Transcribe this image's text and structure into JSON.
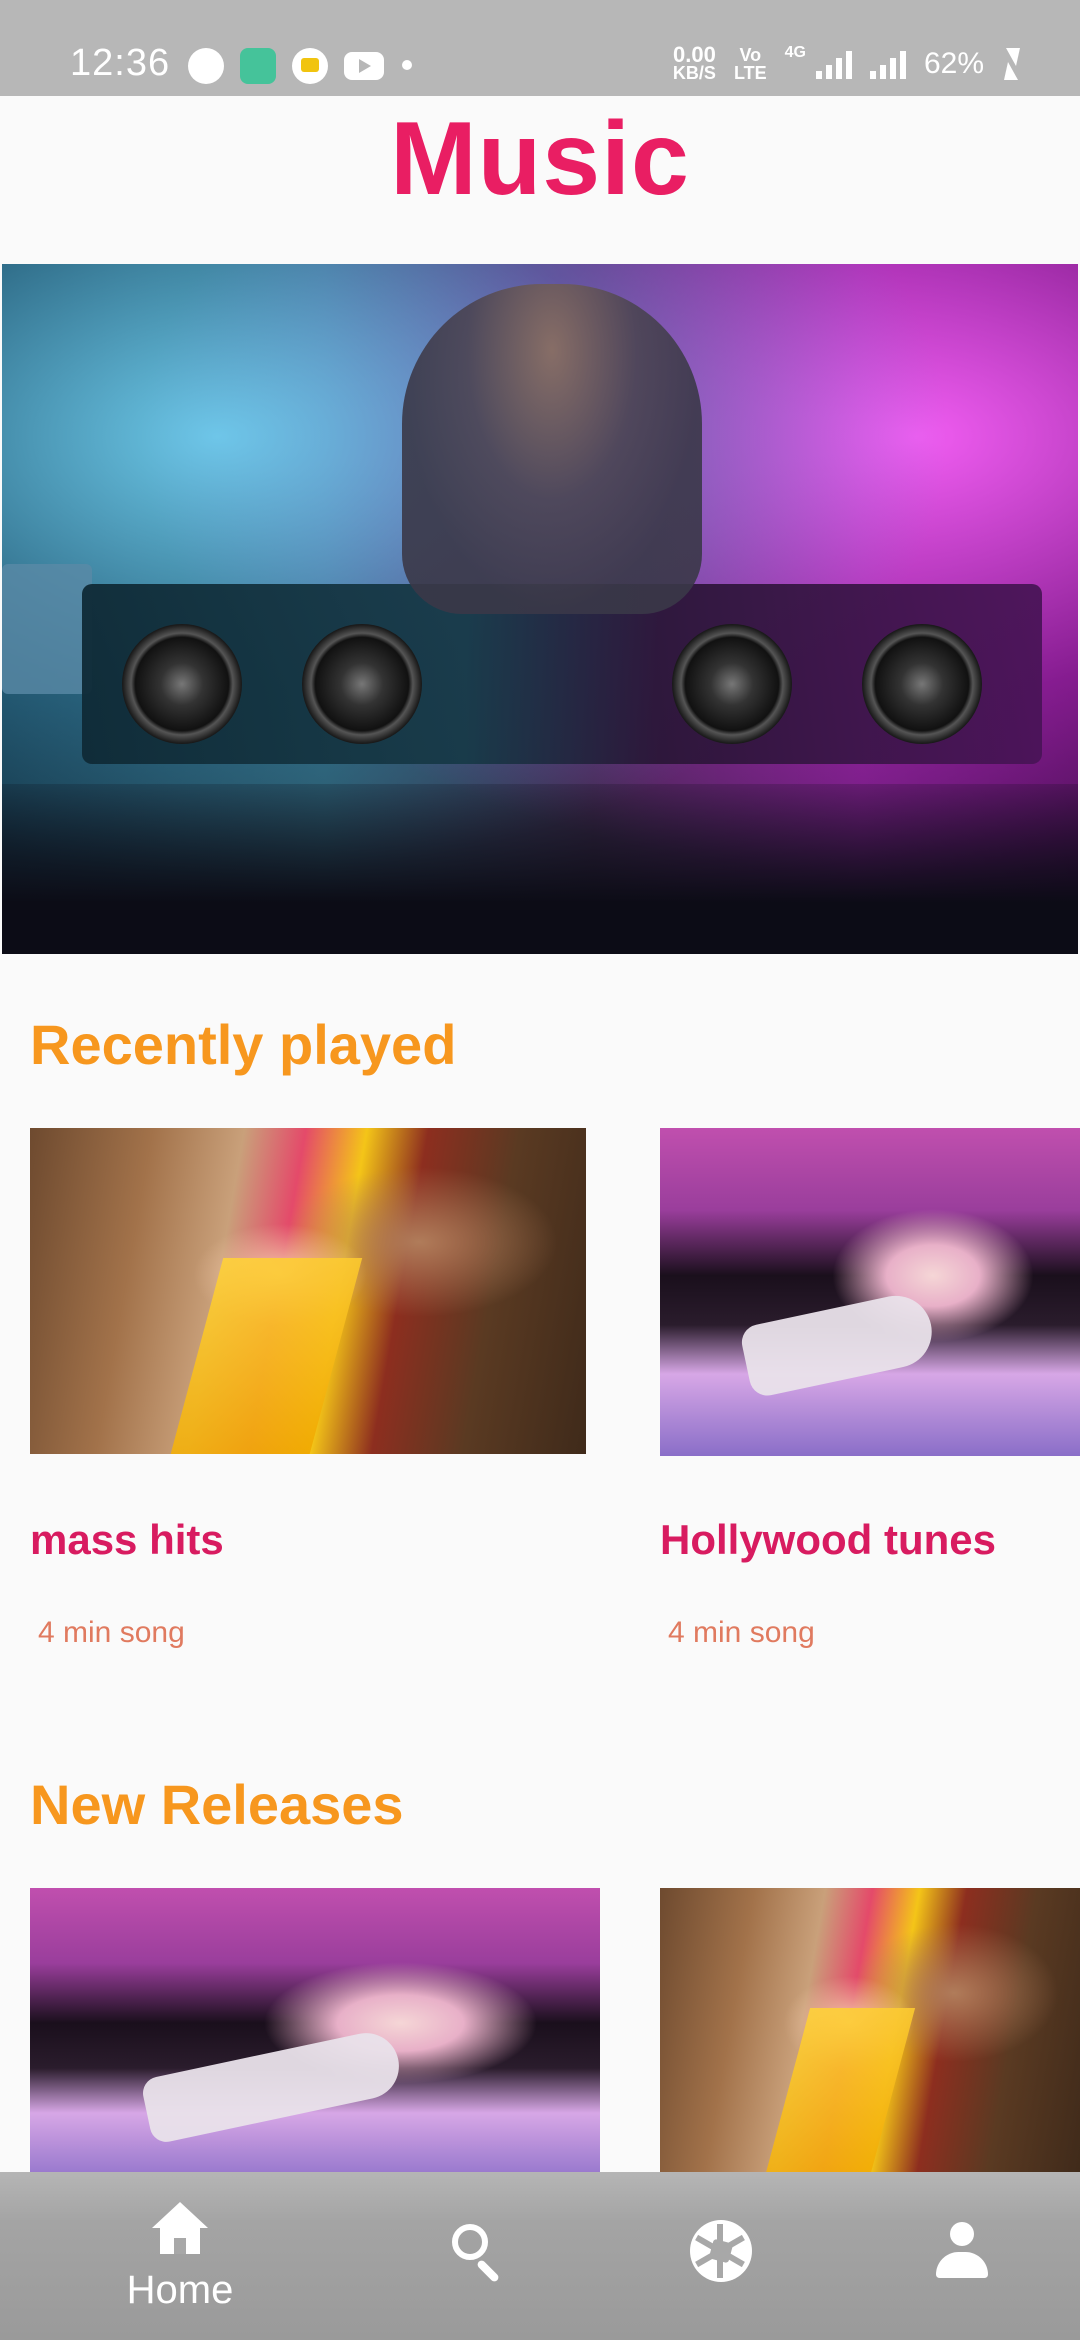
{
  "status_bar": {
    "time": "12:36",
    "data_rate": "0.00",
    "data_unit": "KB/S",
    "volte_top": "Vo",
    "volte_bottom": "LTE",
    "network": "4G",
    "battery": "62%",
    "notification_icons": [
      "pinwheel-icon",
      "app-icon",
      "coins-icon",
      "youtube-icon"
    ]
  },
  "page": {
    "title": "Music"
  },
  "hero": {
    "image": "dj-mixer-photo"
  },
  "recently_played": {
    "title": "Recently played",
    "items": [
      {
        "title": "mass hits",
        "subtitle": "4 min song",
        "image": "crowd-dance-photo"
      },
      {
        "title": "Hollywood tunes",
        "subtitle": "4 min song",
        "image": "woman-headphones-photo"
      }
    ]
  },
  "new_releases": {
    "title": "New Releases",
    "items": [
      {
        "image": "woman-headphones-photo"
      },
      {
        "image": "crowd-dance-photo"
      }
    ]
  },
  "bottom_nav": {
    "items": [
      {
        "label": "Home",
        "icon": "home-icon"
      },
      {
        "label": "",
        "icon": "search-icon"
      },
      {
        "label": "",
        "icon": "aperture-icon"
      },
      {
        "label": "",
        "icon": "person-icon"
      }
    ]
  },
  "colors": {
    "title": "#e91e63",
    "section_title": "#f7971e",
    "card_title": "#d81b60",
    "card_subtitle": "#e07a5f",
    "status_bar": "#b7b7b7",
    "nav_bar": "#a4a4a4"
  }
}
